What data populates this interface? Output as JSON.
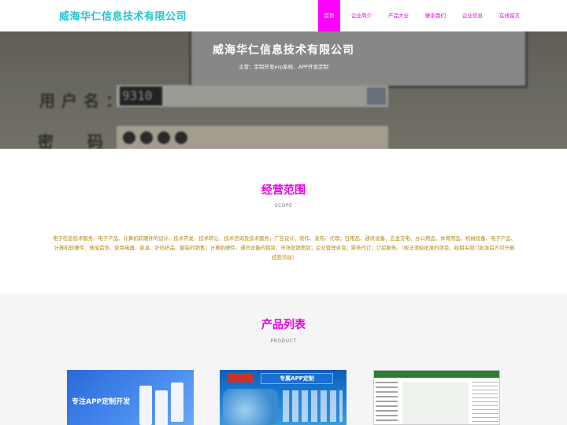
{
  "header": {
    "brand": "威海华仁信息技术有限公司",
    "nav": [
      {
        "label": "首页",
        "active": true
      },
      {
        "label": "企业简介"
      },
      {
        "label": "产品大全"
      },
      {
        "label": "联系我们"
      },
      {
        "label": "企业信息"
      },
      {
        "label": "在线留言"
      }
    ]
  },
  "hero": {
    "title": "威海华仁信息技术有限公司",
    "subtitle": "主营：定制开发erp系统、APP开发定制",
    "image_labels": {
      "username": "用户名：",
      "password": "密 码：",
      "username_value": "9310"
    }
  },
  "scope": {
    "title": "经营范围",
    "subtitle": "SCOPE",
    "text": "电子信息技术服务；电子产品、计算机软硬件的设计、技术开发、技术转让、技术咨询及技术服务；广告设计、制作、发布、代理；日用品、通讯设备、五金交电、办公用品、体育用品、机械设备、电子产品、计算机软硬件、珠宝首饰、家用电器、家具、针纺织品、服装的销售；计算机硬件、通讯设备的租赁；市场营销策划；企业管理咨询；票务代订；订房服务。（依法须经批准的项目，经相关部门批准后方可开展经营活动）"
  },
  "products": {
    "title": "产品列表",
    "subtitle": "PRODUCT",
    "items": [
      {
        "caption": "专注APP定制开发"
      },
      {
        "caption": "专属APP定制"
      },
      {
        "caption": ""
      }
    ]
  },
  "colors": {
    "accent": "#ff00ff",
    "brand": "#22c3d0",
    "scope_text": "#b8860b"
  }
}
